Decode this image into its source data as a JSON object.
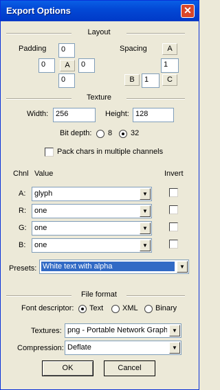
{
  "window": {
    "title": "Export Options",
    "close_label": "✕"
  },
  "layout": {
    "heading": "Layout",
    "padding_label": "Padding",
    "padding_up": "0",
    "padding_left": "0",
    "padding_center": "A",
    "padding_right": "0",
    "padding_down": "0",
    "spacing_label": "Spacing",
    "spacing_a": "A",
    "spacing_vert": "1",
    "spacing_b": "B",
    "spacing_horiz": "1",
    "spacing_c": "C"
  },
  "texture": {
    "heading": "Texture",
    "width_label": "Width:",
    "width": "256",
    "height_label": "Height:",
    "height": "128",
    "bitdepth_label": "Bit depth:",
    "bit8": "8",
    "bit32": "32",
    "selected_bitdepth": "32",
    "pack_label": "Pack chars in multiple channels",
    "pack_checked": false
  },
  "channels": {
    "col_chnl": "Chnl",
    "col_value": "Value",
    "col_invert": "Invert",
    "rows": [
      {
        "chnl": "A:",
        "value": "glyph",
        "invert": false
      },
      {
        "chnl": "R:",
        "value": "one",
        "invert": false
      },
      {
        "chnl": "G:",
        "value": "one",
        "invert": false
      },
      {
        "chnl": "B:",
        "value": "one",
        "invert": false
      }
    ]
  },
  "presets": {
    "label": "Presets:",
    "value": "White text with alpha"
  },
  "file_format": {
    "heading": "File format",
    "descriptor_label": "Font descriptor:",
    "opt_text": "Text",
    "opt_xml": "XML",
    "opt_binary": "Binary",
    "selected_descriptor": "Text",
    "textures_label": "Textures:",
    "textures_value": "png - Portable Network Graphics",
    "compression_label": "Compression:",
    "compression_value": "Deflate"
  },
  "buttons": {
    "ok": "OK",
    "cancel": "Cancel"
  }
}
